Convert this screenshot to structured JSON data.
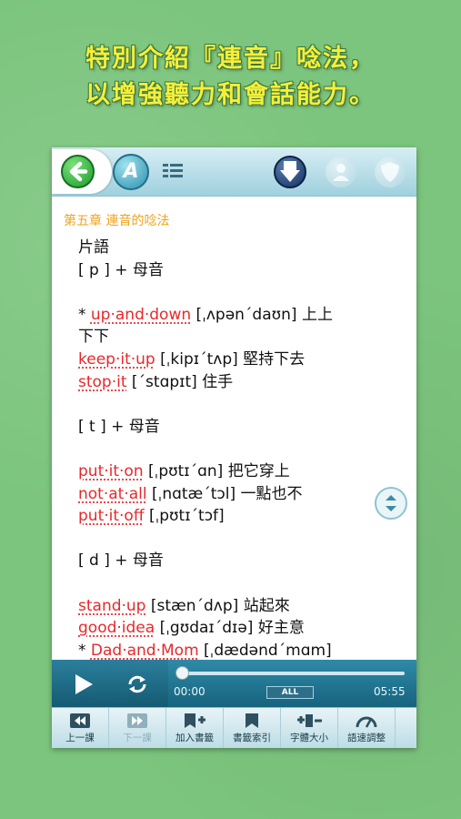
{
  "headline": {
    "line1": "特別介紹『連音』唸法，",
    "line2": "以增強聽力和會話能力。"
  },
  "toolbar": {
    "back_icon": "back-arrow-icon",
    "font_button_label": "A",
    "list_icon": "list-icon",
    "download_icon": "download-icon",
    "user_icon": "user-icon",
    "shield_icon": "shield-icon"
  },
  "content": {
    "chapter_title": "第五章 連音的唸法",
    "lines": [
      {
        "parts": [
          {
            "t": "片語",
            "red": false
          }
        ]
      },
      {
        "parts": [
          {
            "t": "[ p ] + 母音",
            "red": false
          }
        ]
      },
      {
        "blank": true
      },
      {
        "parts": [
          {
            "t": " * ",
            "red": false
          },
          {
            "t": "up·and·down",
            "red": true
          },
          {
            "t": "  [ˌʌpən΄daʊn] 上上",
            "red": false
          }
        ]
      },
      {
        "parts": [
          {
            "t": "下下",
            "red": false
          }
        ]
      },
      {
        "parts": [
          {
            "t": "keep·it·up",
            "red": true
          },
          {
            "t": "  [ˌkipɪ΄tʌp] 堅持下去",
            "red": false
          }
        ]
      },
      {
        "parts": [
          {
            "t": "stop·it",
            "red": true
          },
          {
            "t": "  [΄stɑpɪt] 住手",
            "red": false
          }
        ]
      },
      {
        "blank": true
      },
      {
        "parts": [
          {
            "t": "[ t ] + 母音",
            "red": false
          }
        ]
      },
      {
        "blank": true
      },
      {
        "parts": [
          {
            "t": "put·it·on",
            "red": true
          },
          {
            "t": "  [ˌpʊtɪ΄ɑn] 把它穿上",
            "red": false
          }
        ]
      },
      {
        "parts": [
          {
            "t": "not·at·all",
            "red": true
          },
          {
            "t": "  [ˌnɑtæ΄tɔl] 一點也不",
            "red": false
          }
        ]
      },
      {
        "parts": [
          {
            "t": "put·it·off",
            "red": true
          },
          {
            "t": "  [ˌpʊtɪ΄tɔf]",
            "red": false
          }
        ]
      },
      {
        "blank": true
      },
      {
        "parts": [
          {
            "t": "[ d ] + 母音",
            "red": false
          }
        ]
      },
      {
        "blank": true
      },
      {
        "parts": [
          {
            "t": "stand·up",
            "red": true
          },
          {
            "t": "  [stæn΄dʌp] 站起來",
            "red": false
          }
        ]
      },
      {
        "parts": [
          {
            "t": "good·idea",
            "red": true
          },
          {
            "t": "  [ˌgʊdaɪ΄dɪə] 好主意",
            "red": false
          }
        ]
      },
      {
        "parts": [
          {
            "t": " * ",
            "red": false
          },
          {
            "t": "Dad·and·Mom",
            "red": true
          },
          {
            "t": "  [ˌdædənd΄mɑm]",
            "red": false
          }
        ]
      }
    ]
  },
  "player": {
    "time_start": "00:00",
    "time_end": "05:55",
    "repeat_mode": "ALL",
    "progress": 0.0
  },
  "bottombar": {
    "items": [
      {
        "label": "上一課",
        "icon": "prev-lesson-icon",
        "disabled": false
      },
      {
        "label": "下一課",
        "icon": "next-lesson-icon",
        "disabled": true
      },
      {
        "label": "加入書籤",
        "icon": "add-bookmark-icon",
        "disabled": false
      },
      {
        "label": "書籤索引",
        "icon": "bookmark-index-icon",
        "disabled": false
      },
      {
        "label": "字體大小",
        "icon": "font-size-icon",
        "disabled": false
      },
      {
        "label": "語速調整",
        "icon": "speed-adjust-icon",
        "disabled": false
      }
    ]
  },
  "colors": {
    "background": "#7cc57e",
    "headline": "#f7ee3a",
    "chapter": "#f2a21c",
    "term": "#e8282b",
    "player": "#1f7390"
  }
}
